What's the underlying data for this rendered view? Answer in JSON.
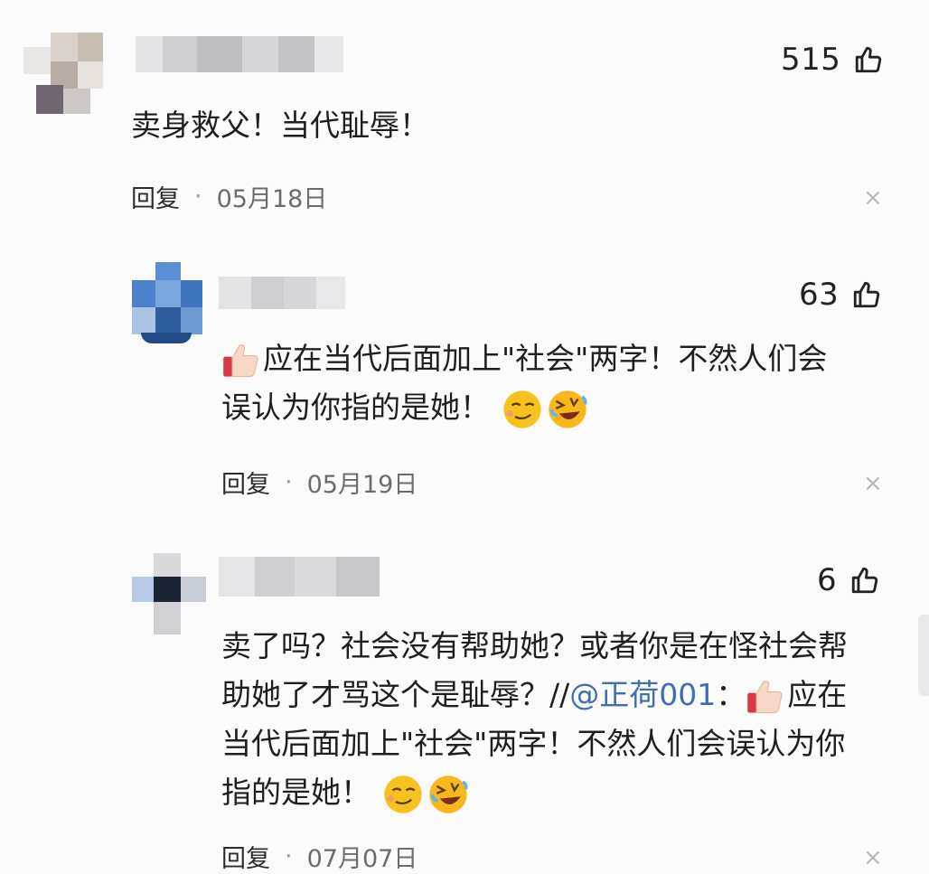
{
  "comments": [
    {
      "text_lines": [
        "卖身救父！当代耻辱！"
      ],
      "likes": "515",
      "reply_label": "回复",
      "separator": "·",
      "date": "05月18日",
      "close": "×"
    },
    {
      "text_lines": [
        "应在当代后面加上\"社会\"两字！不然人们会",
        "误认为你指的是她！"
      ],
      "likes": "63",
      "reply_label": "回复",
      "separator": "·",
      "date": "05月19日",
      "close": "×"
    },
    {
      "text_lines": [
        "卖了吗？社会没有帮助她？或者你是在怪社会帮",
        "助她了才骂这个是耻辱？//",
        "：",
        "应在",
        "当代后面加上\"社会\"两字！不然人们会误认为你",
        "指的是她！"
      ],
      "mention": "@正荷001",
      "likes": "6",
      "reply_label": "回复",
      "separator": "·",
      "date": "07月07日",
      "close": "×"
    }
  ],
  "icons": {
    "like": "thumbs-up-outline-icon",
    "close": "close-icon",
    "emoji_thumb": "thumbs-up-emoji",
    "emoji_smirk": "smirk-emoji",
    "emoji_laugh": "rolling-laugh-emoji"
  },
  "colors": {
    "background": "#fbfbfc",
    "text": "#1f1f1f",
    "meta": "#6c6c6c",
    "mention": "#3f6fb2"
  }
}
